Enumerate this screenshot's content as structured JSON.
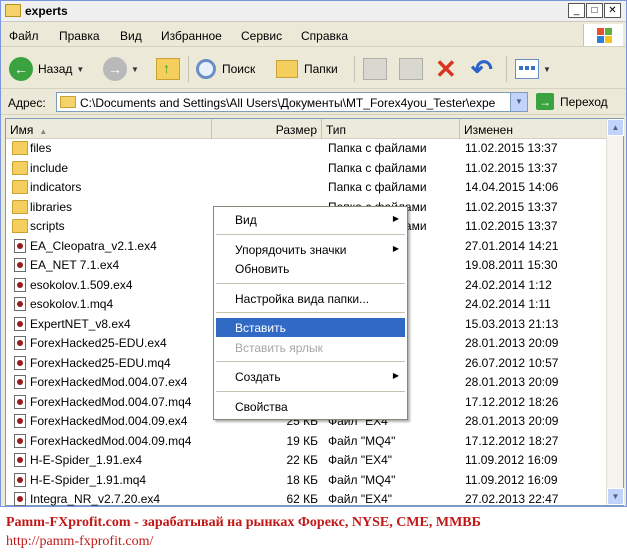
{
  "window": {
    "title": "experts"
  },
  "titlebar_buttons": {
    "minimize": "_",
    "maximize": "□",
    "close": "✕"
  },
  "menu": [
    "Файл",
    "Правка",
    "Вид",
    "Избранное",
    "Сервис",
    "Справка"
  ],
  "toolbar": {
    "back": "Назад",
    "search": "Поиск",
    "folders": "Папки"
  },
  "address": {
    "label": "Адрес:",
    "value": "C:\\Documents and Settings\\All Users\\Документы\\MT_Forex4you_Tester\\expe",
    "go": "Переход"
  },
  "columns": {
    "name": "Имя",
    "size": "Размер",
    "type": "Тип",
    "modified": "Изменен"
  },
  "files": [
    {
      "name": "files",
      "size": "",
      "type": "Папка с файлами",
      "modified": "11.02.2015 13:37",
      "kind": "folder"
    },
    {
      "name": "include",
      "size": "",
      "type": "Папка с файлами",
      "modified": "11.02.2015 13:37",
      "kind": "folder"
    },
    {
      "name": "indicators",
      "size": "",
      "type": "Папка с файлами",
      "modified": "14.04.2015 14:06",
      "kind": "folder"
    },
    {
      "name": "libraries",
      "size": "",
      "type": "Папка с файлами",
      "modified": "11.02.2015 13:37",
      "kind": "folder"
    },
    {
      "name": "scripts",
      "size": "",
      "type": "Папка с файлами",
      "modified": "11.02.2015 13:37",
      "kind": "folder"
    },
    {
      "name": "EA_Cleopatra_v2.1.ex4",
      "size": "",
      "type": "",
      "modified": "27.01.2014 14:21",
      "kind": "file"
    },
    {
      "name": "EA_NET 7.1.ex4",
      "size": "",
      "type": "",
      "modified": "19.08.2011 15:30",
      "kind": "file"
    },
    {
      "name": "esokolov.1.509.ex4",
      "size": "",
      "type": "",
      "modified": "24.02.2014 1:12",
      "kind": "file"
    },
    {
      "name": "esokolov.1.mq4",
      "size": "",
      "type": "",
      "modified": "24.02.2014 1:11",
      "kind": "file"
    },
    {
      "name": "ExpertNET_v8.ex4",
      "size": "",
      "type": "",
      "modified": "15.03.2013 21:13",
      "kind": "file"
    },
    {
      "name": "ForexHacked25-EDU.ex4",
      "size": "",
      "type": "",
      "modified": "28.01.2013 20:09",
      "kind": "file"
    },
    {
      "name": "ForexHacked25-EDU.mq4",
      "size": "",
      "type": "",
      "modified": "26.07.2012 10:57",
      "kind": "file"
    },
    {
      "name": "ForexHackedMod.004.07.ex4",
      "size": "",
      "type": "",
      "modified": "28.01.2013 20:09",
      "kind": "file"
    },
    {
      "name": "ForexHackedMod.004.07.mq4",
      "size": "",
      "type": "",
      "modified": "17.12.2012 18:26",
      "kind": "file"
    },
    {
      "name": "ForexHackedMod.004.09.ex4",
      "size": "25 КБ",
      "type": "Файл \"EX4\"",
      "modified": "28.01.2013 20:09",
      "kind": "file"
    },
    {
      "name": "ForexHackedMod.004.09.mq4",
      "size": "19 КБ",
      "type": "Файл \"MQ4\"",
      "modified": "17.12.2012 18:27",
      "kind": "file"
    },
    {
      "name": "H-E-Spider_1.91.ex4",
      "size": "22 КБ",
      "type": "Файл \"EX4\"",
      "modified": "11.09.2012 16:09",
      "kind": "file"
    },
    {
      "name": "H-E-Spider_1.91.mq4",
      "size": "18 КБ",
      "type": "Файл \"MQ4\"",
      "modified": "11.09.2012 16:09",
      "kind": "file"
    },
    {
      "name": "Integra_NR_v2.7.20.ex4",
      "size": "62 КБ",
      "type": "Файл \"EX4\"",
      "modified": "27.02.2013 22:47",
      "kind": "file"
    }
  ],
  "context_menu": [
    {
      "label": "Вид",
      "submenu": true
    },
    {
      "sep": true
    },
    {
      "label": "Упорядочить значки",
      "submenu": true
    },
    {
      "label": "Обновить"
    },
    {
      "sep": true
    },
    {
      "label": "Настройка вида папки..."
    },
    {
      "sep": true
    },
    {
      "label": "Вставить",
      "highlighted": true
    },
    {
      "label": "Вставить ярлык",
      "disabled": true
    },
    {
      "sep": true
    },
    {
      "label": "Создать",
      "submenu": true
    },
    {
      "sep": true
    },
    {
      "label": "Свойства"
    }
  ],
  "footer": {
    "line1": "Pamm-FXprofit.com - зарабатывай на рынках Форекс, NYSE, CME, ММВБ",
    "line2": "http://pamm-fxprofit.com/"
  },
  "colors": {
    "selection": "#316ac5",
    "watermark": "#c01818",
    "folder": "#f5cf5e"
  }
}
